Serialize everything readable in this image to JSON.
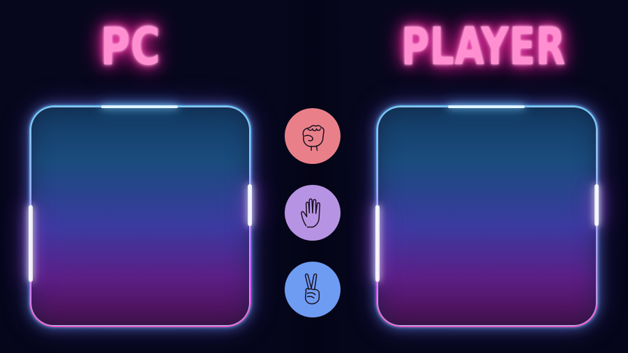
{
  "pc": {
    "title": "PC"
  },
  "player": {
    "title": "PLAYER"
  },
  "choices": [
    {
      "id": "rock",
      "icon": "fist-icon",
      "color": "#e98089"
    },
    {
      "id": "paper",
      "icon": "open-hand-icon",
      "color": "#b794e3"
    },
    {
      "id": "scissors",
      "icon": "peace-hand-icon",
      "color": "#6f9cf3"
    }
  ],
  "colors": {
    "title_neon": "#ff8fd0",
    "background": "#05061a",
    "frame_border": "#bedcff"
  }
}
